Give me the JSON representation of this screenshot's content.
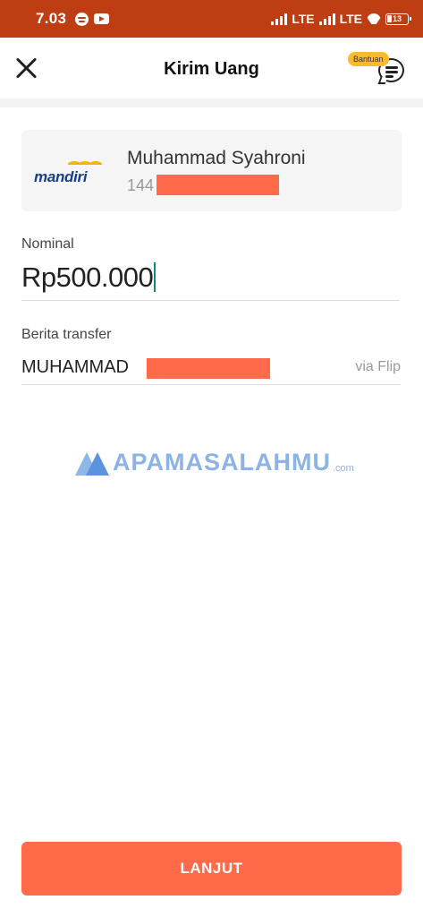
{
  "status_bar": {
    "time": "7.03",
    "network_1": "LTE",
    "network_2": "LTE",
    "battery": "13"
  },
  "header": {
    "title": "Kirim Uang",
    "help_badge": "Bantuan"
  },
  "recipient": {
    "bank_name": "mandiri",
    "name": "Muhammad Syahroni",
    "account_prefix": "144"
  },
  "form": {
    "nominal_label": "Nominal",
    "nominal_value": "Rp500.000",
    "message_label": "Berita transfer",
    "message_value": "MUHAMMAD",
    "message_suffix": "via Flip"
  },
  "watermark": {
    "text": "APAMASALAHMU",
    "suffix": ".com"
  },
  "actions": {
    "continue_label": "LANJUT"
  },
  "colors": {
    "status_bar": "#bf3d12",
    "accent": "#ff6a48",
    "badge": "#fdb92c",
    "caret": "#0b8a8a"
  }
}
